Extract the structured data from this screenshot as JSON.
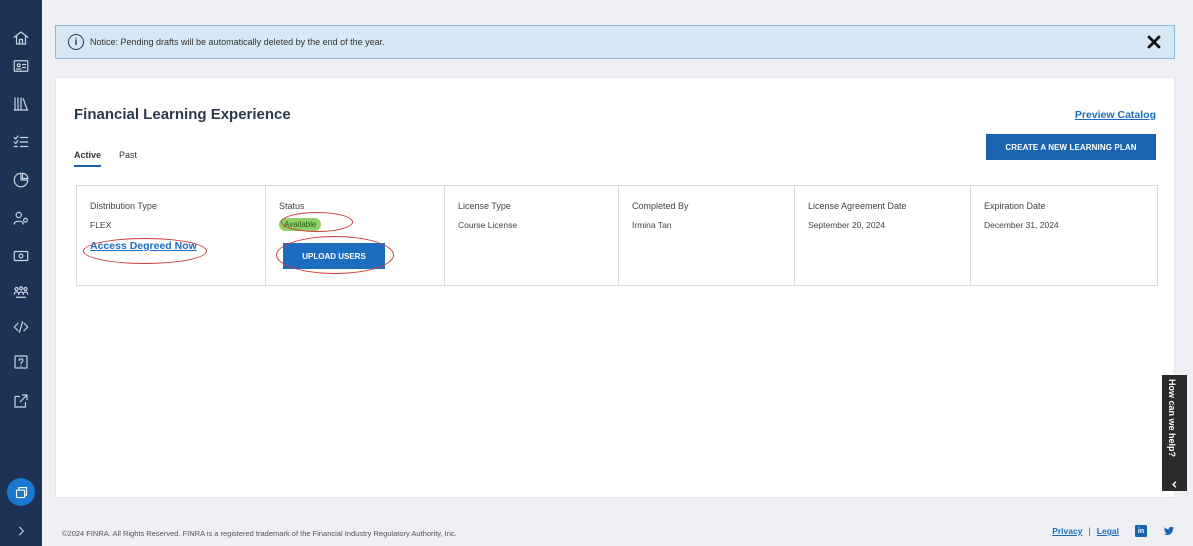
{
  "notice": {
    "text": "Notice: Pending drafts will be automatically deleted by the end of the year.",
    "icon_glyph": "i"
  },
  "page": {
    "title": "Financial Learning Experience",
    "preview_catalog_label": "Preview Catalog",
    "create_plan_label": "CREATE A NEW LEARNING PLAN",
    "tabs": [
      {
        "label": "Active",
        "active": true
      },
      {
        "label": "Past",
        "active": false
      }
    ]
  },
  "plan": {
    "headers": [
      "Distribution Type",
      "Status",
      "License Type",
      "Completed By",
      "License Agreement Date",
      "Expiration Date"
    ],
    "distribution_type": "FLEX",
    "access_link_label": "Access Degreed Now",
    "status": "Available",
    "upload_users_label": "UPLOAD USERS",
    "license_type": "Course License",
    "completed_by": "Irmina Tan",
    "license_agreement_date": "September 20, 2024",
    "expiration_date": "December 31, 2024"
  },
  "help": {
    "label": "How can we help?"
  },
  "footer": {
    "copyright": "©2024 FINRA. All Rights Reserved. FINRA is a registered trademark of the Financial Industry Regulatory Authority, Inc.",
    "privacy_label": "Privacy",
    "separator": "|",
    "legal_label": "Legal",
    "linkedin_glyph": "in"
  },
  "colors": {
    "sidebar": "#1d3355",
    "primary": "#1b64b0",
    "link": "#1b6dbf",
    "available": "#8fd06a",
    "annotation": "#d23a3a"
  }
}
